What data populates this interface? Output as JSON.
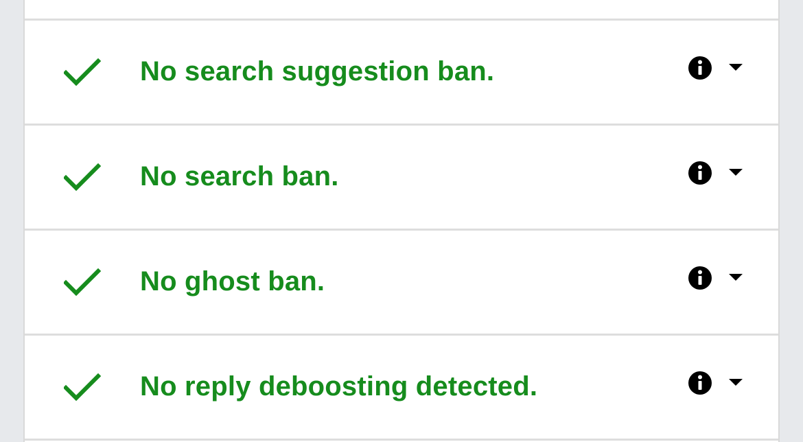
{
  "results": [
    {
      "id": "suggestion",
      "status_icon": "checkmark-icon",
      "text": "No search suggestion ban.",
      "info_icon": "info-icon",
      "toggle_icon": "caret-down-icon"
    },
    {
      "id": "search",
      "status_icon": "checkmark-icon",
      "text": "No search ban.",
      "info_icon": "info-icon",
      "toggle_icon": "caret-down-icon"
    },
    {
      "id": "ghost",
      "status_icon": "checkmark-icon",
      "text": "No ghost ban.",
      "info_icon": "info-icon",
      "toggle_icon": "caret-down-icon"
    },
    {
      "id": "reply",
      "status_icon": "checkmark-icon",
      "text": "No reply deboosting detected.",
      "info_icon": "info-icon",
      "toggle_icon": "caret-down-icon"
    }
  ],
  "colors": {
    "success": "#168c1d",
    "icon": "#000000",
    "background": "#e7e9ec",
    "card": "#ffffff",
    "divider": "#dddddd"
  }
}
